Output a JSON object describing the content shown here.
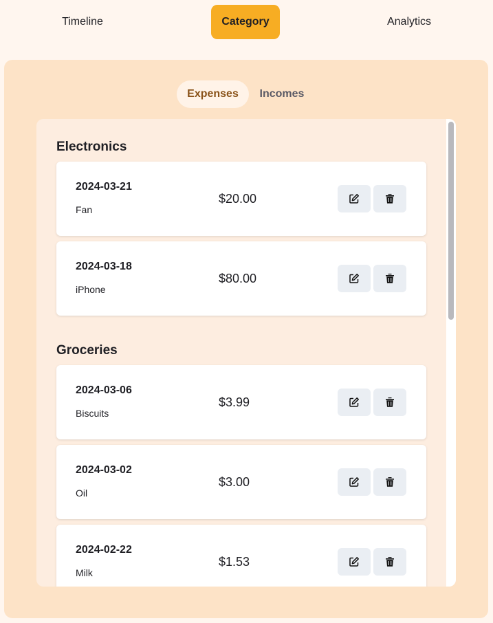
{
  "nav": {
    "items": [
      {
        "label": "Timeline",
        "active": false
      },
      {
        "label": "Category",
        "active": true
      },
      {
        "label": "Analytics",
        "active": false
      }
    ]
  },
  "subtabs": [
    {
      "label": "Expenses",
      "active": true
    },
    {
      "label": "Incomes",
      "active": false
    }
  ],
  "categories": [
    {
      "name": "Electronics",
      "entries": [
        {
          "date": "2024-03-21",
          "description": "Fan",
          "amount": "$20.00"
        },
        {
          "date": "2024-03-18",
          "description": "iPhone",
          "amount": "$80.00"
        }
      ]
    },
    {
      "name": "Groceries",
      "entries": [
        {
          "date": "2024-03-06",
          "description": "Biscuits",
          "amount": "$3.99"
        },
        {
          "date": "2024-03-02",
          "description": "Oil",
          "amount": "$3.00"
        },
        {
          "date": "2024-02-22",
          "description": "Milk",
          "amount": "$1.53"
        }
      ]
    }
  ],
  "icons": {
    "edit": "edit-icon",
    "delete": "trash-icon"
  },
  "colors": {
    "accent": "#f7ad23",
    "panel": "#fde3c7",
    "page": "#fff6ef"
  }
}
